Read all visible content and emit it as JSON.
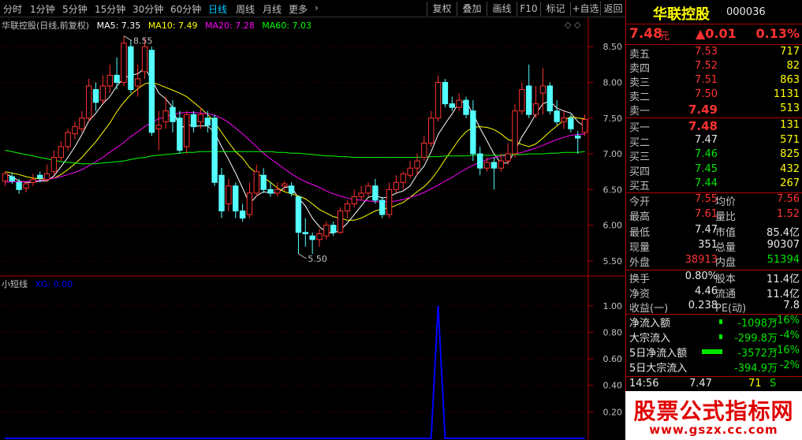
{
  "toolbar": {
    "periods": [
      "分时",
      "1分钟",
      "5分钟",
      "15分钟",
      "30分钟",
      "60分钟",
      "日线",
      "周线",
      "月线",
      "更多"
    ],
    "active_period": "日线",
    "more_arrow": "›",
    "buttons": [
      "复权",
      "叠加",
      "画线",
      "F10",
      "标记",
      "+自选",
      "返回"
    ]
  },
  "chart": {
    "title": "华联控股(日线,前复权)",
    "ma_labels": [
      {
        "text": "MA5: 7.35",
        "color": "#ffffff"
      },
      {
        "text": "MA10: 7.49",
        "color": "#ffff00"
      },
      {
        "text": "MA20: 7.28",
        "color": "#ff00ff"
      },
      {
        "text": "MA60: 7.03",
        "color": "#00ff00"
      }
    ],
    "diamonds": "◇ ◇",
    "high_marker": "8.55",
    "low_marker": "5.50",
    "y_ticks": [
      "8.50",
      "8.00",
      "7.50",
      "7.00",
      "6.50",
      "6.00",
      "5.50"
    ],
    "indicator_name": "小短线",
    "indicator_value": "XG: 0.00",
    "indicator_ticks": [
      "1.00",
      "0.80",
      "0.60",
      "0.40",
      "0.20"
    ]
  },
  "chart_data": {
    "type": "candlestick",
    "ylim": [
      5.4,
      8.8
    ],
    "candles": [
      [
        6.62,
        6.72,
        6.55,
        6.75
      ],
      [
        6.68,
        6.62,
        6.58,
        6.74
      ],
      [
        6.6,
        6.5,
        6.44,
        6.65
      ],
      [
        6.52,
        6.58,
        6.46,
        6.62
      ],
      [
        6.6,
        6.64,
        6.55,
        6.72
      ],
      [
        6.7,
        6.66,
        6.6,
        6.75
      ],
      [
        6.64,
        6.72,
        6.6,
        6.85
      ],
      [
        6.75,
        6.95,
        6.7,
        7.05
      ],
      [
        6.95,
        7.1,
        6.9,
        7.18
      ],
      [
        7.1,
        7.3,
        7.05,
        7.35
      ],
      [
        7.28,
        7.38,
        7.2,
        7.45
      ],
      [
        7.35,
        7.5,
        7.3,
        7.6
      ],
      [
        7.5,
        7.95,
        7.45,
        8.05
      ],
      [
        7.9,
        7.72,
        7.6,
        8.0
      ],
      [
        7.75,
        7.95,
        7.7,
        8.1
      ],
      [
        7.95,
        8.1,
        7.85,
        8.25
      ],
      [
        8.1,
        8.0,
        7.9,
        8.35
      ],
      [
        8.0,
        8.55,
        7.95,
        8.65
      ],
      [
        8.5,
        7.9,
        7.85,
        8.6
      ],
      [
        7.95,
        8.05,
        7.8,
        8.25
      ],
      [
        8.15,
        8.5,
        8.05,
        8.62
      ],
      [
        8.45,
        7.3,
        7.25,
        8.5
      ],
      [
        7.35,
        7.4,
        7.05,
        7.6
      ],
      [
        7.45,
        7.6,
        7.35,
        7.8
      ],
      [
        7.65,
        7.45,
        7.3,
        7.75
      ],
      [
        7.5,
        7.05,
        7.0,
        7.6
      ],
      [
        7.1,
        7.55,
        7.0,
        7.6
      ],
      [
        7.55,
        7.38,
        7.3,
        7.6
      ],
      [
        7.45,
        7.55,
        7.35,
        7.65
      ],
      [
        7.5,
        7.4,
        7.3,
        7.6
      ],
      [
        7.5,
        6.6,
        6.55,
        7.55
      ],
      [
        6.7,
        6.2,
        6.1,
        6.8
      ],
      [
        6.3,
        6.55,
        6.2,
        6.65
      ],
      [
        6.55,
        6.2,
        6.1,
        6.6
      ],
      [
        6.2,
        6.1,
        6.05,
        6.3
      ],
      [
        6.15,
        6.45,
        6.1,
        6.6
      ],
      [
        6.45,
        6.75,
        6.4,
        6.85
      ],
      [
        6.7,
        6.5,
        6.45,
        6.8
      ],
      [
        6.5,
        6.45,
        6.4,
        6.6
      ],
      [
        6.45,
        6.5,
        6.4,
        6.6
      ],
      [
        6.55,
        6.58,
        6.48,
        6.62
      ],
      [
        6.55,
        6.45,
        6.4,
        6.6
      ],
      [
        6.4,
        5.9,
        5.6,
        6.4
      ],
      [
        5.9,
        5.88,
        5.7,
        6.1
      ],
      [
        5.85,
        5.8,
        5.6,
        5.9
      ],
      [
        5.8,
        5.88,
        5.7,
        5.95
      ],
      [
        5.85,
        6.0,
        5.8,
        6.05
      ],
      [
        6.0,
        5.9,
        5.85,
        6.05
      ],
      [
        5.9,
        6.2,
        5.88,
        6.25
      ],
      [
        6.2,
        6.3,
        6.1,
        6.35
      ],
      [
        6.3,
        6.4,
        6.25,
        6.5
      ],
      [
        6.4,
        6.45,
        6.35,
        6.55
      ],
      [
        6.45,
        6.55,
        6.4,
        6.6
      ],
      [
        6.55,
        6.35,
        6.3,
        6.65
      ],
      [
        6.35,
        6.15,
        6.1,
        6.4
      ],
      [
        6.15,
        6.5,
        6.1,
        6.6
      ],
      [
        6.5,
        6.6,
        6.45,
        6.7
      ],
      [
        6.6,
        6.72,
        6.5,
        6.75
      ],
      [
        6.7,
        6.8,
        6.65,
        6.9
      ],
      [
        6.8,
        6.9,
        6.7,
        7.0
      ],
      [
        6.95,
        7.15,
        6.9,
        7.25
      ],
      [
        7.15,
        7.5,
        7.1,
        7.6
      ],
      [
        7.5,
        8.0,
        7.45,
        8.1
      ],
      [
        8.0,
        7.7,
        7.65,
        8.05
      ],
      [
        7.7,
        7.65,
        7.6,
        7.8
      ],
      [
        7.65,
        7.75,
        7.6,
        7.85
      ],
      [
        7.75,
        7.55,
        7.5,
        7.8
      ],
      [
        7.6,
        7.0,
        6.9,
        7.75
      ],
      [
        7.0,
        6.8,
        6.7,
        7.1
      ],
      [
        6.8,
        6.88,
        6.75,
        6.95
      ],
      [
        6.88,
        6.8,
        6.5,
        6.95
      ],
      [
        6.8,
        6.9,
        6.75,
        7.0
      ],
      [
        6.9,
        7.0,
        6.85,
        7.15
      ],
      [
        7.0,
        7.6,
        6.95,
        7.7
      ],
      [
        7.6,
        7.9,
        7.55,
        8.0
      ],
      [
        7.95,
        7.55,
        7.5,
        8.25
      ],
      [
        7.55,
        7.7,
        7.5,
        7.95
      ],
      [
        7.85,
        7.95,
        7.55,
        8.2
      ],
      [
        7.95,
        7.6,
        7.55,
        8.0
      ],
      [
        7.6,
        7.45,
        7.4,
        7.75
      ],
      [
        7.45,
        7.5,
        7.35,
        7.6
      ],
      [
        7.5,
        7.35,
        7.3,
        7.55
      ],
      [
        7.25,
        7.22,
        7.0,
        7.32
      ],
      [
        7.3,
        7.48,
        7.25,
        7.55
      ]
    ],
    "ma": [
      {
        "name": "MA5",
        "color": "#ffffff",
        "values": [
          6.72,
          6.68,
          6.62,
          6.6,
          6.6,
          6.62,
          6.62,
          6.69,
          6.82,
          6.95,
          7.1,
          7.27,
          7.46,
          7.57,
          7.7,
          7.8,
          7.95,
          8.06,
          8.1,
          8.12,
          8.2,
          8.04,
          7.85,
          7.77,
          7.65,
          7.35,
          7.41,
          7.39,
          7.39,
          7.39,
          7.3,
          7.1,
          6.92,
          6.73,
          6.52,
          6.3,
          6.41,
          6.47,
          6.45,
          6.45,
          6.53,
          6.54,
          6.38,
          6.27,
          6.1,
          5.98,
          5.9,
          5.89,
          5.93,
          6.03,
          6.15,
          6.27,
          6.39,
          6.42,
          6.38,
          6.4,
          6.45,
          6.48,
          6.55,
          6.71,
          6.83,
          7.03,
          7.27,
          7.42,
          7.56,
          7.72,
          7.73,
          7.56,
          7.36,
          7.18,
          7.0,
          6.87,
          6.87,
          7.04,
          7.24,
          7.39,
          7.56,
          7.7,
          7.74,
          7.64,
          7.6,
          7.57,
          7.45,
          7.38
        ]
      },
      {
        "name": "MA10",
        "color": "#ffff00",
        "values": [
          6.75,
          6.73,
          6.71,
          6.68,
          6.66,
          6.65,
          6.65,
          6.66,
          6.71,
          6.78,
          6.86,
          6.95,
          7.06,
          7.17,
          7.3,
          7.43,
          7.59,
          7.72,
          7.83,
          7.91,
          7.98,
          8.0,
          7.97,
          7.93,
          7.89,
          7.85,
          7.8,
          7.72,
          7.64,
          7.55,
          7.44,
          7.3,
          7.16,
          7.03,
          6.94,
          6.81,
          6.73,
          6.67,
          6.6,
          6.52,
          6.47,
          6.44,
          6.41,
          6.37,
          6.3,
          6.22,
          6.17,
          6.12,
          6.1,
          6.07,
          6.07,
          6.1,
          6.15,
          6.2,
          6.23,
          6.24,
          6.28,
          6.32,
          6.39,
          6.47,
          6.54,
          6.64,
          6.77,
          6.92,
          7.06,
          7.2,
          7.31,
          7.37,
          7.38,
          7.37,
          7.34,
          7.28,
          7.2,
          7.17,
          7.13,
          7.1,
          7.14,
          7.22,
          7.31,
          7.39,
          7.47,
          7.52,
          7.5,
          7.49
        ]
      },
      {
        "name": "MA20",
        "color": "#ff00ff",
        "values": [
          6.6,
          6.61,
          6.61,
          6.61,
          6.62,
          6.63,
          6.64,
          6.66,
          6.68,
          6.71,
          6.74,
          6.78,
          6.83,
          6.89,
          6.95,
          7.02,
          7.09,
          7.16,
          7.24,
          7.31,
          7.38,
          7.44,
          7.49,
          7.52,
          7.55,
          7.57,
          7.58,
          7.58,
          7.57,
          7.56,
          7.54,
          7.5,
          7.44,
          7.36,
          7.28,
          7.19,
          7.1,
          7.01,
          6.93,
          6.86,
          6.79,
          6.72,
          6.66,
          6.61,
          6.57,
          6.53,
          6.48,
          6.44,
          6.41,
          6.38,
          6.36,
          6.35,
          6.34,
          6.33,
          6.33,
          6.33,
          6.34,
          6.36,
          6.39,
          6.42,
          6.46,
          6.51,
          6.56,
          6.62,
          6.67,
          6.73,
          6.79,
          6.84,
          6.88,
          6.92,
          6.95,
          6.97,
          6.98,
          7.0,
          7.02,
          7.05,
          7.08,
          7.12,
          7.16,
          7.2,
          7.23,
          7.26,
          7.27,
          7.28
        ]
      },
      {
        "name": "MA60",
        "color": "#00ff00",
        "values": [
          7.05,
          7.03,
          7.01,
          6.99,
          6.97,
          6.95,
          6.93,
          6.91,
          6.89,
          6.88,
          6.87,
          6.86,
          6.86,
          6.86,
          6.87,
          6.88,
          6.89,
          6.9,
          6.92,
          6.94,
          6.95,
          6.97,
          6.98,
          6.99,
          7.0,
          7.01,
          7.02,
          7.02,
          7.03,
          7.03,
          7.03,
          7.03,
          7.03,
          7.03,
          7.03,
          7.03,
          7.03,
          7.03,
          7.03,
          7.02,
          7.02,
          7.01,
          7.01,
          7.0,
          6.99,
          6.98,
          6.97,
          6.97,
          6.96,
          6.96,
          6.95,
          6.95,
          6.95,
          6.95,
          6.95,
          6.95,
          6.95,
          6.95,
          6.95,
          6.95,
          6.96,
          6.96,
          6.96,
          6.97,
          6.97,
          6.97,
          6.97,
          6.98,
          6.98,
          6.98,
          6.98,
          6.98,
          6.99,
          6.99,
          6.99,
          7.0,
          7.0,
          7.0,
          7.01,
          7.01,
          7.02,
          7.02,
          7.02,
          7.03
        ]
      }
    ],
    "indicator": {
      "name": "XG",
      "ylim": [
        0,
        1.1
      ],
      "signal_index": 62,
      "signal_value": 1.0
    }
  },
  "panel": {
    "stock_name": "华联控股",
    "stock_code": "000036",
    "price": "7.48",
    "price_unit": "元",
    "change": "▲0.01",
    "change_pct": "0.13%",
    "asks": [
      {
        "label": "卖五",
        "price": "7.53",
        "vol": "717"
      },
      {
        "label": "卖四",
        "price": "7.52",
        "vol": "82"
      },
      {
        "label": "卖三",
        "price": "7.51",
        "vol": "863"
      },
      {
        "label": "卖二",
        "price": "7.50",
        "vol": "1131"
      },
      {
        "label": "卖一",
        "price": "7.49",
        "vol": "513"
      }
    ],
    "bids": [
      {
        "label": "买一",
        "price": "7.48",
        "vol": "131"
      },
      {
        "label": "买二",
        "price": "7.47",
        "vol": "571"
      },
      {
        "label": "买三",
        "price": "7.46",
        "vol": "825"
      },
      {
        "label": "买四",
        "price": "7.45",
        "vol": "432"
      },
      {
        "label": "买五",
        "price": "7.44",
        "vol": "267"
      }
    ],
    "stats": [
      {
        "l1": "今开",
        "v1": "7.55",
        "l2": "均价",
        "v2": "7.56"
      },
      {
        "l1": "最高",
        "v1": "7.61",
        "l2": "量比",
        "v2": "1.52"
      },
      {
        "l1": "最低",
        "v1": "7.47",
        "l2": "市值",
        "v2": "85.4亿"
      },
      {
        "l1": "现量",
        "v1": "351",
        "l2": "总量",
        "v2": "90307"
      },
      {
        "l1": "外盘",
        "v1": "38913",
        "l2": "内盘",
        "v2": "51394"
      }
    ],
    "fund": [
      {
        "l1": "换手",
        "v1": "0.80%",
        "l2": "股本",
        "v2": "11.4亿"
      },
      {
        "l1": "净资",
        "v1": "4.46",
        "l2": "流通",
        "v2": "11.4亿"
      },
      {
        "l1": "收益(一)",
        "v1": "0.238",
        "l2": "PE(动)",
        "v2": "7.8"
      }
    ],
    "flows": [
      {
        "label": "净流入额",
        "value": "-1098万",
        "pct": "-16%",
        "bar": 0.15
      },
      {
        "label": "大宗流入",
        "value": "-299.8万",
        "pct": "-4%",
        "bar": 0.04
      },
      {
        "label": "5日净流入额",
        "value": "-3572万",
        "pct": "-16%",
        "bar": 1.0
      },
      {
        "label": "5日大宗流入",
        "value": "-394.9万",
        "pct": "-2%",
        "bar": 0.0
      }
    ],
    "tick": {
      "time": "14:56",
      "price": "7.47",
      "vol": "71",
      "side": "S"
    },
    "banner_title": "股票公式指标网",
    "banner_url": "www.gszx.cc.com"
  }
}
